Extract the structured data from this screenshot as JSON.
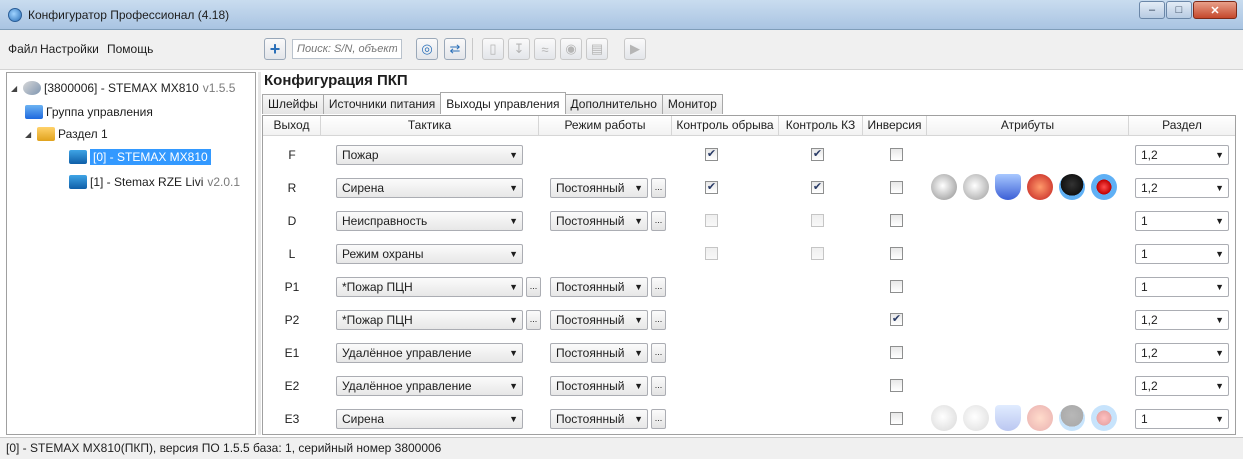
{
  "window": {
    "title": "Конфигуратор Профессионал (4.18)"
  },
  "menu": {
    "file": "Файл",
    "settings": "Настройки",
    "help": "Помощь"
  },
  "toolbar": {
    "search_placeholder": "Поиск: S/N, объект"
  },
  "tree": {
    "device": {
      "label": "[3800006] - STEMAX MX810",
      "version": "v1.5.5"
    },
    "group": {
      "label": "Группа управления"
    },
    "section": {
      "label": "Раздел 1"
    },
    "devices": [
      {
        "label": "[0] - STEMAX MX810",
        "version": ""
      },
      {
        "label": "[1] - Stemax RZE Livi",
        "version": "v2.0.1"
      }
    ]
  },
  "config": {
    "title": "Конфигурация ПКП",
    "tabs": [
      "Шлейфы",
      "Источники питания",
      "Выходы управления",
      "Дополнительно",
      "Монитор"
    ],
    "active_tab": "Выходы управления",
    "columns": {
      "output": "Выход",
      "tactic": "Тактика",
      "mode": "Режим работы",
      "break_control": "Контроль обрыва",
      "short_control": "Контроль КЗ",
      "inversion": "Инверсия",
      "attributes": "Атрибуты",
      "section": "Раздел"
    },
    "rows": [
      {
        "output": "F",
        "tactic": "Пожар",
        "tactic_extra": false,
        "mode": "",
        "break": true,
        "short": true,
        "break_enabled": true,
        "inversion": false,
        "attrs": "none",
        "section": "1,2"
      },
      {
        "output": "R",
        "tactic": "Сирена",
        "tactic_extra": false,
        "mode": "Постоянный",
        "break": true,
        "short": true,
        "break_enabled": true,
        "inversion": false,
        "attrs": "full",
        "section": "1,2"
      },
      {
        "output": "D",
        "tactic": "Неисправность",
        "tactic_extra": false,
        "mode": "Постоянный",
        "break": false,
        "short": false,
        "break_enabled": false,
        "inversion": false,
        "attrs": "none",
        "section": "1"
      },
      {
        "output": "L",
        "tactic": "Режим охраны",
        "tactic_extra": false,
        "mode": "",
        "break": false,
        "short": false,
        "break_enabled": false,
        "inversion": false,
        "attrs": "none",
        "section": "1"
      },
      {
        "output": "P1",
        "tactic": "*Пожар ПЦН",
        "tactic_extra": true,
        "mode": "Постоянный",
        "break": null,
        "short": null,
        "inversion": false,
        "attrs": "none",
        "section": "1"
      },
      {
        "output": "P2",
        "tactic": "*Пожар ПЦН",
        "tactic_extra": true,
        "mode": "Постоянный",
        "break": null,
        "short": null,
        "inversion": true,
        "attrs": "none",
        "section": "1,2"
      },
      {
        "output": "E1",
        "tactic": "Удалённое управление",
        "tactic_extra": false,
        "mode": "Постоянный",
        "break": null,
        "short": null,
        "inversion": false,
        "attrs": "none",
        "section": "1,2"
      },
      {
        "output": "E2",
        "tactic": "Удалённое управление",
        "tactic_extra": false,
        "mode": "Постоянный",
        "break": null,
        "short": null,
        "inversion": false,
        "attrs": "none",
        "section": "1,2"
      },
      {
        "output": "E3",
        "tactic": "Сирена",
        "tactic_extra": false,
        "mode": "Постоянный",
        "break": null,
        "short": null,
        "inversion": false,
        "attrs": "faded",
        "section": "1"
      }
    ]
  },
  "status": {
    "text": "[0] - STEMAX MX810(ПКП), версия ПО 1.5.5 база: 1, серийный номер 3800006"
  }
}
